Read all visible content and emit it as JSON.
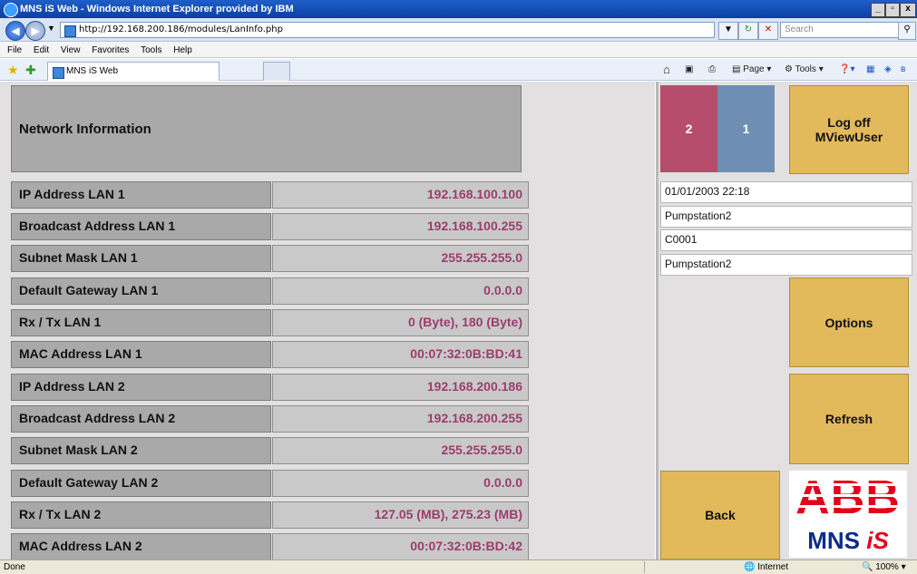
{
  "window": {
    "title": "MNS iS Web - Windows Internet Explorer provided by IBM",
    "address": "http://192.168.200.186/modules/LanInfo.php",
    "search_placeholder": "Search"
  },
  "menu": [
    "File",
    "Edit",
    "View",
    "Favorites",
    "Tools",
    "Help"
  ],
  "tab": {
    "label": "MNS iS Web"
  },
  "toolbar_right": {
    "page_label": "Page",
    "tools_label": "Tools"
  },
  "main": {
    "title": "Network Information",
    "rows": [
      {
        "label": "IP Address LAN 1",
        "value": "192.168.100.100"
      },
      {
        "label": "Broadcast Address LAN 1",
        "value": "192.168.100.255"
      },
      {
        "label": "Subnet Mask LAN 1",
        "value": "255.255.255.0"
      },
      {
        "label": "Default Gateway LAN 1",
        "value": "0.0.0.0"
      },
      {
        "label": "Rx / Tx LAN 1",
        "value": "0 (Byte), 180 (Byte)"
      },
      {
        "label": "MAC Address LAN 1",
        "value": "00:07:32:0B:BD:41"
      },
      {
        "label": "IP Address LAN 2",
        "value": "192.168.200.186"
      },
      {
        "label": "Broadcast Address LAN 2",
        "value": "192.168.200.255"
      },
      {
        "label": "Subnet Mask LAN 2",
        "value": "255.255.255.0"
      },
      {
        "label": "Default Gateway LAN 2",
        "value": "0.0.0.0"
      },
      {
        "label": "Rx / Tx LAN 2",
        "value": "127.05 (MB), 275.23 (MB)"
      },
      {
        "label": "MAC Address LAN 2",
        "value": "00:07:32:0B:BD:42"
      }
    ]
  },
  "side": {
    "counter_a": "2",
    "counter_b": "1",
    "logoff_line1": "Log off",
    "logoff_line2": "MViewUser",
    "datetime": "01/01/2003 22:18",
    "info1": "Pumpstation2",
    "info2": "C0001",
    "info3": "Pumpstation2",
    "options_label": "Options",
    "refresh_label": "Refresh",
    "back_label": "Back",
    "logo_text": "ABB",
    "logo_sub_a": "MNS ",
    "logo_sub_b": "iS"
  },
  "status": {
    "text": "Done",
    "zone": "Internet",
    "zoom": "100%"
  },
  "colors": {
    "value_text": "#9d3c70",
    "counter_a_bg": "#b64d6c",
    "counter_b_bg": "#6e8fb3",
    "button_bg": "#e2b95b",
    "abb_red": "#e4001b",
    "mns_blue": "#0b2c8c"
  }
}
